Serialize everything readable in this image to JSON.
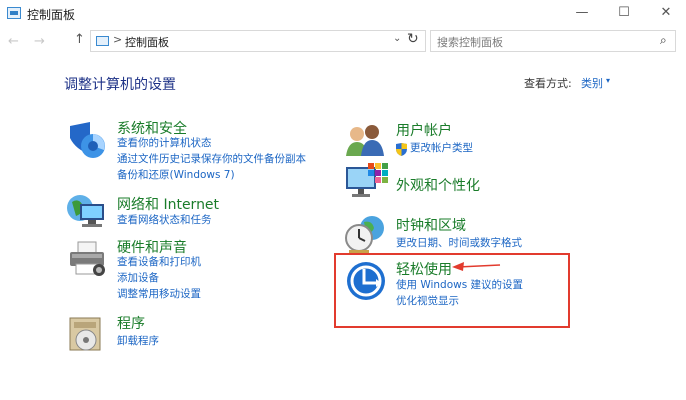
{
  "window": {
    "title": "控制面板",
    "minimize_glyph": "—",
    "maximize_glyph": "☐",
    "close_glyph": "✕"
  },
  "address": {
    "back_glyph": "←",
    "forward_glyph": "→",
    "up_glyph": "↑",
    "separator": ">",
    "path": "控制面板",
    "dropdown_glyph": "⌄",
    "refresh_glyph": "↻",
    "search_placeholder": "搜索控制面板",
    "search_glyph": "⌕"
  },
  "header": {
    "title": "调整计算机的设置",
    "view_label": "查看方式:",
    "view_value": "类别",
    "view_caret": "▾"
  },
  "left_categories": [
    {
      "title": "系统和安全",
      "icon": "shield-icon",
      "links": [
        "查看你的计算机状态",
        "通过文件历史记录保存你的文件备份副本",
        "备份和还原(Windows 7)"
      ]
    },
    {
      "title": "网络和 Internet",
      "icon": "network-globe-icon",
      "links": [
        "查看网络状态和任务"
      ]
    },
    {
      "title": "硬件和声音",
      "icon": "printer-icon",
      "links": [
        "查看设备和打印机",
        "添加设备",
        "调整常用移动设置"
      ]
    },
    {
      "title": "程序",
      "icon": "program-disc-icon",
      "links": [
        "卸载程序"
      ]
    }
  ],
  "right_categories": [
    {
      "title": "用户帐户",
      "icon": "users-icon",
      "links": [
        "更改帐户类型"
      ],
      "link_icon": "uac-shield-icon"
    },
    {
      "title": "外观和个性化",
      "icon": "monitor-palette-icon",
      "links": []
    },
    {
      "title": "时钟和区域",
      "icon": "clock-globe-icon",
      "links": [
        "更改日期、时间或数字格式"
      ]
    },
    {
      "title": "轻松使用",
      "icon": "ease-of-access-icon",
      "links": [
        "使用 Windows 建议的设置",
        "优化视觉显示"
      ]
    }
  ],
  "colors": {
    "category_title": "#1a7c2a",
    "link": "#1c66c4",
    "heading": "#1e3287",
    "highlight": "#e23b2e"
  }
}
